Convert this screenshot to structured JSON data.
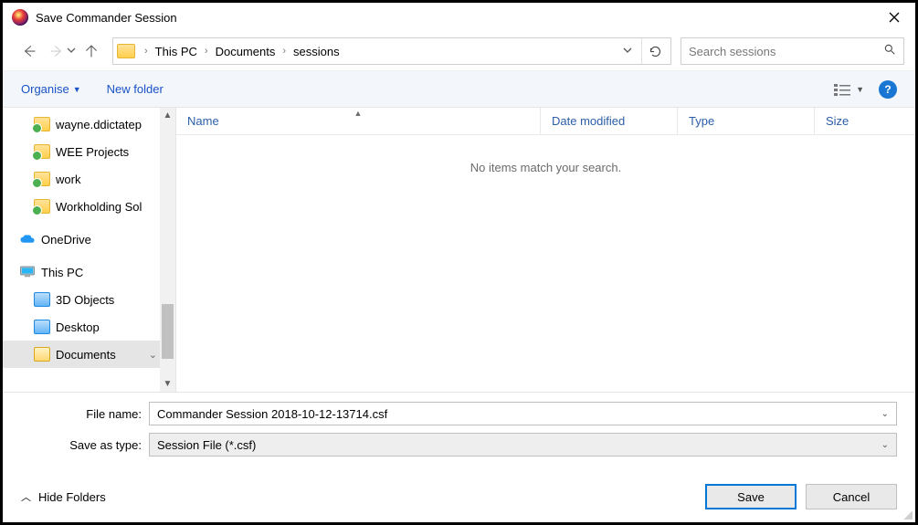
{
  "title": "Save Commander Session",
  "breadcrumb": [
    "This PC",
    "Documents",
    "sessions"
  ],
  "search_placeholder": "Search sessions",
  "toolbar": {
    "organise": "Organise",
    "new_folder": "New folder"
  },
  "tree": {
    "sync_folders": [
      "wayne.ddictatep",
      "WEE Projects",
      "work",
      "Workholding Sol"
    ],
    "onedrive": "OneDrive",
    "thispc": "This PC",
    "pc_children": [
      "3D Objects",
      "Desktop",
      "Documents"
    ]
  },
  "columns": {
    "name": "Name",
    "date": "Date modified",
    "type": "Type",
    "size": "Size"
  },
  "empty_text": "No items match your search.",
  "filename_label": "File name:",
  "filename_value": "Commander Session 2018-10-12-13714.csf",
  "filetype_label": "Save as type:",
  "filetype_value": "Session File (*.csf)",
  "hide_folders_label": "Hide Folders",
  "buttons": {
    "save": "Save",
    "cancel": "Cancel"
  }
}
